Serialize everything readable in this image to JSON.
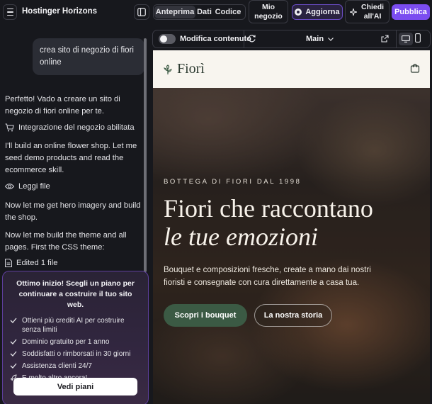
{
  "topbar": {
    "app_title": "Hostinger Horizons",
    "tabs": [
      "Anteprima",
      "Dati",
      "Codice"
    ],
    "mio_negozio_line1": "Mio",
    "mio_negozio_line2": "negozio",
    "aggiorna": "Aggiorna",
    "chiedi_line1": "Chiedi",
    "chiedi_line2": "all'AI",
    "pubblica": "Pubblica"
  },
  "chat": {
    "user_message": "crea sito di negozio di fiori online",
    "p1": "Perfetto! Vado a creare un sito di negozio di fiori online per te.",
    "tool1": "Integrazione del negozio abilitata",
    "p2": "I'll build an online flower shop. Let me seed demo products and read the ecommerce skill.",
    "tool2": "Leggi file",
    "p3": "Now let me get hero imagery and build the shop.",
    "p4": "Now let me build the theme and all pages. First the CSS theme:",
    "tool3": "Edited 1 file"
  },
  "promo": {
    "title": "Ottimo inizio! Scegli un piano per continuare a costruire il tuo sito web.",
    "features": [
      "Ottieni più crediti AI per costruire senza limiti",
      "Dominio gratuito per 1 anno",
      "Soddisfatti o rimborsati in 30 giorni",
      "Assistenza clienti 24/7",
      "E molto altro ancora!"
    ],
    "cta": "Vedi piani"
  },
  "preview": {
    "edit_label": "Modifica contenuto",
    "branch": "Main"
  },
  "site": {
    "logo": "Fiorì",
    "eyebrow": "BOTTEGA DI FIORI DAL 1998",
    "headline_1": "Fiori che raccontano",
    "headline_2": "le tue emozioni",
    "subtitle": "Bouquet e composizioni fresche, create a mano dai nostri fioristi e consegnate con cura direttamente a casa tua.",
    "cta_primary": "Scopri i bouquet",
    "cta_secondary": "La nostra storia"
  },
  "colors": {
    "accent": "#7b4df0",
    "brand_green": "#3b5a44",
    "background": "#17181d"
  }
}
